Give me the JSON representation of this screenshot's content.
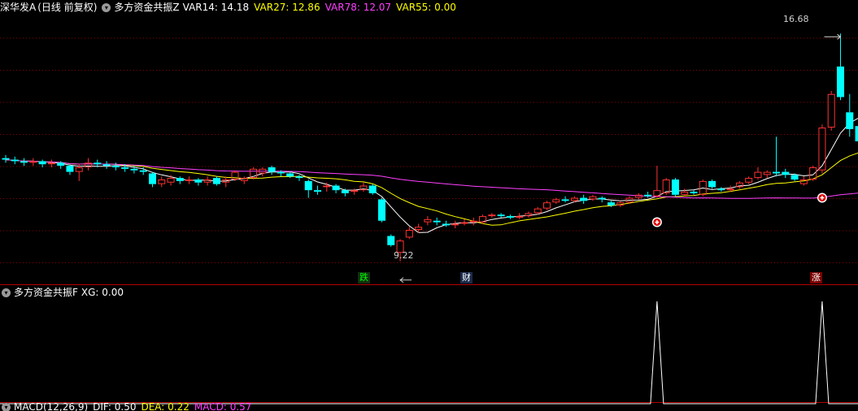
{
  "main_header": {
    "symbol": "深华发A",
    "period": "(日线 前复权)",
    "indicator_name": "多方资金共振Z",
    "vars": [
      {
        "label": "VAR14: 14.18",
        "color": "#ffffff"
      },
      {
        "label": "VAR27: 12.86",
        "color": "#ffff00"
      },
      {
        "label": "VAR78: 12.07",
        "color": "#ff40ff"
      },
      {
        "label": "VAR55: 0.00",
        "color": "#ffff00"
      }
    ]
  },
  "sub_header": {
    "indicator_name": "多方资金共振F",
    "vars": [
      {
        "label": "XG: 0.00",
        "color": "#ffffff"
      }
    ]
  },
  "bottom_header": {
    "vars": [
      {
        "label": "MACD(12,26,9)",
        "color": "#ffffff"
      },
      {
        "label": "DIF: 0.50",
        "color": "#ffffff"
      },
      {
        "label": "DEA: 0.22",
        "color": "#ffff00"
      },
      {
        "label": "MACD: 0.57",
        "color": "#ff40ff"
      }
    ]
  },
  "annotations": {
    "high_label": "16.68",
    "low_label": "9.22",
    "tag_die": "跌",
    "tag_cai": "财",
    "tag_zhang": "涨"
  },
  "colors": {
    "up": "#ff3232",
    "down": "#00ffff",
    "ma_white": "#ffffff",
    "ma_yellow": "#ffff00",
    "ma_magenta": "#ff40ff",
    "grid": "#8b0000",
    "separator": "#b40000"
  },
  "chart_data": {
    "type": "candlestick",
    "price_range": [
      9.0,
      17.3
    ],
    "candles": [
      [
        12.6,
        12.55,
        12.7,
        12.45
      ],
      [
        12.55,
        12.5,
        12.65,
        12.4
      ],
      [
        12.5,
        12.45,
        12.6,
        12.35
      ],
      [
        12.45,
        12.5,
        12.6,
        12.35
      ],
      [
        12.5,
        12.4,
        12.55,
        12.3
      ],
      [
        12.4,
        12.45,
        12.55,
        12.3
      ],
      [
        12.45,
        12.35,
        12.5,
        12.25
      ],
      [
        12.35,
        12.15,
        12.4,
        12.05
      ],
      [
        12.15,
        12.3,
        12.4,
        11.85
      ],
      [
        12.3,
        12.45,
        12.6,
        12.2
      ],
      [
        12.45,
        12.4,
        12.55,
        12.3
      ],
      [
        12.4,
        12.35,
        12.5,
        12.25
      ],
      [
        12.35,
        12.3,
        12.45,
        12.2
      ],
      [
        12.3,
        12.25,
        12.4,
        12.15
      ],
      [
        12.25,
        12.2,
        12.35,
        12.1
      ],
      [
        12.2,
        12.15,
        12.3,
        12.05
      ],
      [
        12.1,
        11.75,
        12.15,
        11.65
      ],
      [
        11.75,
        11.9,
        12.0,
        11.65
      ],
      [
        11.8,
        11.95,
        12.05,
        11.7
      ],
      [
        11.95,
        11.85,
        12.0,
        11.75
      ],
      [
        11.85,
        11.9,
        12.0,
        11.75
      ],
      [
        11.9,
        11.8,
        11.95,
        11.7
      ],
      [
        11.8,
        11.9,
        12.0,
        11.7
      ],
      [
        11.95,
        11.75,
        12.0,
        11.7
      ],
      [
        11.8,
        11.9,
        12.0,
        11.65
      ],
      [
        11.9,
        12.15,
        12.2,
        11.85
      ],
      [
        11.85,
        11.95,
        12.0,
        11.75
      ],
      [
        11.95,
        12.25,
        12.3,
        11.9
      ],
      [
        12.1,
        12.25,
        12.3,
        12.0
      ],
      [
        12.3,
        12.15,
        12.35,
        12.05
      ],
      [
        12.15,
        12.1,
        12.2,
        12.0
      ],
      [
        12.1,
        12.0,
        12.15,
        11.95
      ],
      [
        12.0,
        11.95,
        12.05,
        11.85
      ],
      [
        11.85,
        11.55,
        11.9,
        11.3
      ],
      [
        11.55,
        11.5,
        11.7,
        11.4
      ],
      [
        11.65,
        11.7,
        11.8,
        11.5
      ],
      [
        11.7,
        11.55,
        11.75,
        11.45
      ],
      [
        11.55,
        11.45,
        11.6,
        11.35
      ],
      [
        11.5,
        11.55,
        11.6,
        11.4
      ],
      [
        11.55,
        11.7,
        11.8,
        11.5
      ],
      [
        11.7,
        11.45,
        11.75,
        11.4
      ],
      [
        11.25,
        10.55,
        11.3,
        10.5
      ],
      [
        10.05,
        9.75,
        10.1,
        9.7
      ],
      [
        9.5,
        9.9,
        9.95,
        9.22
      ],
      [
        10.0,
        10.25,
        10.35,
        9.95
      ],
      [
        10.25,
        10.35,
        10.45,
        10.15
      ],
      [
        10.5,
        10.6,
        10.7,
        10.4
      ],
      [
        10.55,
        10.5,
        10.65,
        10.4
      ],
      [
        10.45,
        10.4,
        10.55,
        10.35
      ],
      [
        10.4,
        10.45,
        10.55,
        10.3
      ],
      [
        10.45,
        10.5,
        10.6,
        10.4
      ],
      [
        10.5,
        10.55,
        10.65,
        10.4
      ],
      [
        10.5,
        10.7,
        10.75,
        10.45
      ],
      [
        10.7,
        10.75,
        10.8,
        10.65
      ],
      [
        10.75,
        10.7,
        10.8,
        10.65
      ],
      [
        10.7,
        10.65,
        10.75,
        10.6
      ],
      [
        10.65,
        10.7,
        10.8,
        10.6
      ],
      [
        10.7,
        10.8,
        10.85,
        10.65
      ],
      [
        10.8,
        10.95,
        11.0,
        10.75
      ],
      [
        10.95,
        11.15,
        11.2,
        10.9
      ],
      [
        11.15,
        11.25,
        11.3,
        11.1
      ],
      [
        11.25,
        11.2,
        11.35,
        11.15
      ],
      [
        11.2,
        11.3,
        11.35,
        11.15
      ],
      [
        11.3,
        11.2,
        11.4,
        11.1
      ],
      [
        11.25,
        11.35,
        11.4,
        11.2
      ],
      [
        11.3,
        11.25,
        11.35,
        11.15
      ],
      [
        11.15,
        11.05,
        11.2,
        11.0
      ],
      [
        11.05,
        11.15,
        11.2,
        11.0
      ],
      [
        11.15,
        11.3,
        11.35,
        11.1
      ],
      [
        11.3,
        11.4,
        11.45,
        11.25
      ],
      [
        11.4,
        11.35,
        11.5,
        11.3
      ],
      [
        11.35,
        11.55,
        12.35,
        11.3
      ],
      [
        11.45,
        11.9,
        11.95,
        11.4
      ],
      [
        11.9,
        11.4,
        11.95,
        11.35
      ],
      [
        11.4,
        11.5,
        11.6,
        11.35
      ],
      [
        11.5,
        11.45,
        11.55,
        11.4
      ],
      [
        11.4,
        11.85,
        11.9,
        11.35
      ],
      [
        11.85,
        11.65,
        11.9,
        11.6
      ],
      [
        11.6,
        11.55,
        11.65,
        11.5
      ],
      [
        11.55,
        11.6,
        11.7,
        11.5
      ],
      [
        11.65,
        11.8,
        11.85,
        11.6
      ],
      [
        11.8,
        11.95,
        12.0,
        11.75
      ],
      [
        11.95,
        12.15,
        12.3,
        11.9
      ],
      [
        12.05,
        12.15,
        12.2,
        11.95
      ],
      [
        12.15,
        12.1,
        13.3,
        12.0
      ],
      [
        12.15,
        12.05,
        12.25,
        11.95
      ],
      [
        12.05,
        11.9,
        12.1,
        11.85
      ],
      [
        11.75,
        11.9,
        12.0,
        11.7
      ],
      [
        11.9,
        12.3,
        12.35,
        11.85
      ],
      [
        12.2,
        13.6,
        13.7,
        12.1
      ],
      [
        13.6,
        14.7,
        14.8,
        13.5
      ],
      [
        15.6,
        14.6,
        16.68,
        14.5
      ],
      [
        14.1,
        13.55,
        14.7,
        13.3
      ],
      [
        13.65,
        13.15,
        13.7,
        13.05
      ]
    ],
    "signal_markers": [
      71,
      89
    ],
    "xg_spikes": [
      71,
      89
    ]
  }
}
